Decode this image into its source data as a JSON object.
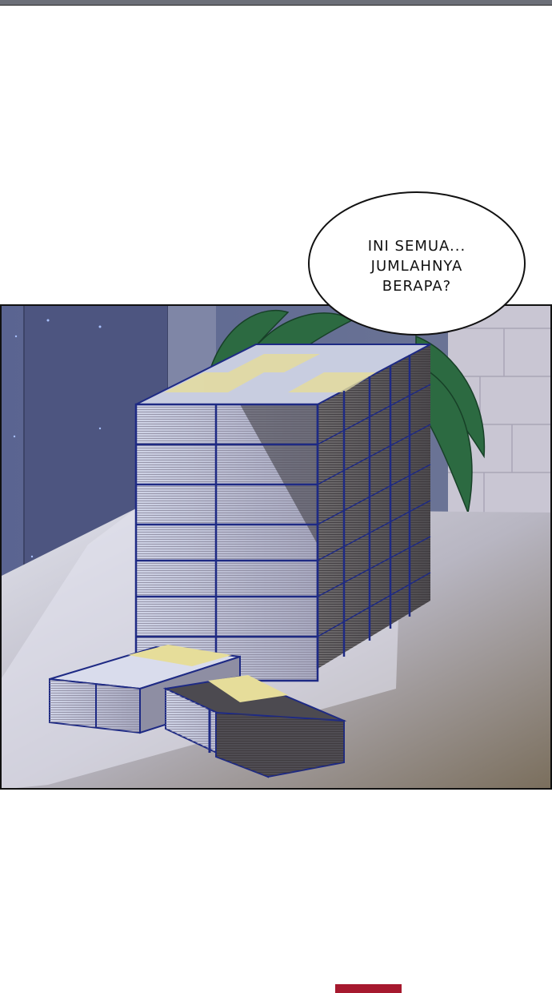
{
  "comic": {
    "speech_bubble": {
      "lines": [
        "INI SEMUA...",
        "JUMLAHNYA",
        "BERAPA?"
      ]
    },
    "scene": {
      "subject": "stacks-of-banknotes",
      "colors": {
        "wall": "#535c86",
        "table_light": "#d9d9e4",
        "table_dark": "#7f7566",
        "money_face": "#bfc6dc",
        "money_edge": "#8f8ba0",
        "band": "#1e2a84",
        "plant": "#2a6a3f"
      }
    },
    "nav_bar": {
      "color": "#a6192e"
    }
  }
}
